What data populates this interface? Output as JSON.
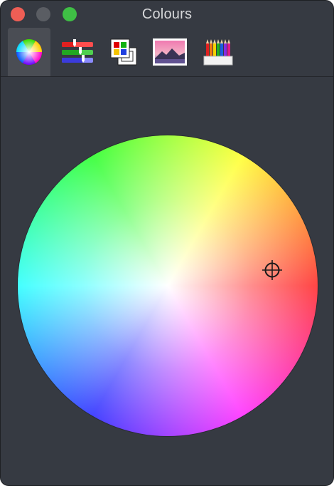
{
  "window": {
    "title": "Colours"
  },
  "toolbar": {
    "tabs": [
      {
        "name": "colour-wheel",
        "icon": "colour-wheel-icon",
        "selected": true
      },
      {
        "name": "colour-sliders",
        "icon": "sliders-icon",
        "selected": false
      },
      {
        "name": "colour-palettes",
        "icon": "palettes-icon",
        "selected": false
      },
      {
        "name": "image-palettes",
        "icon": "image-icon",
        "selected": false
      },
      {
        "name": "pencils",
        "icon": "pencils-icon",
        "selected": false
      }
    ]
  },
  "colors": {
    "window_bg": "#363a42",
    "selected_tab_bg": "#4a4d54",
    "close": "#ee5e55",
    "minimize": "#5a5d63",
    "zoom": "#3fbf45",
    "title_text": "#d7d8da"
  }
}
